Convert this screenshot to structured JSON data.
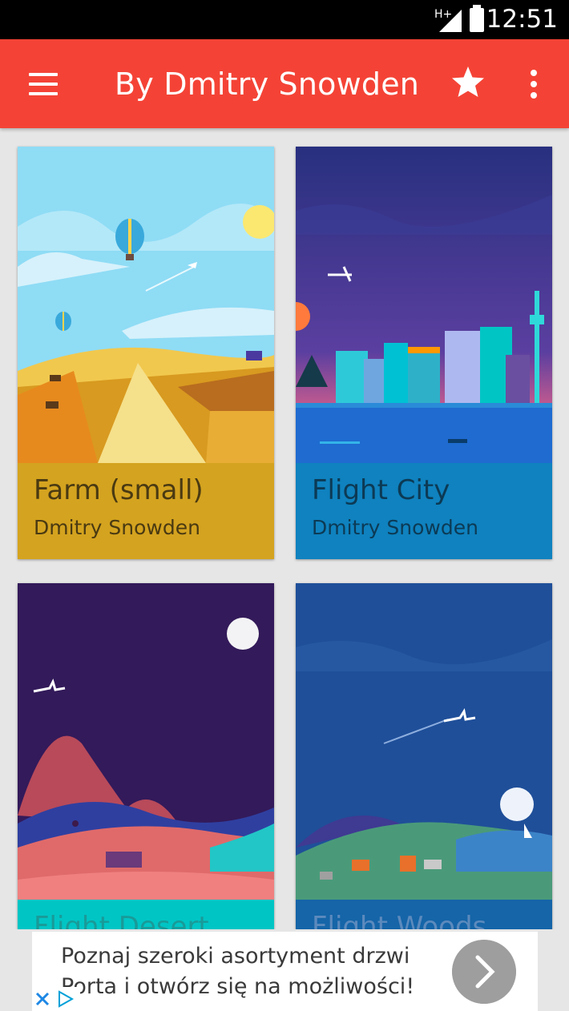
{
  "status_bar": {
    "time": "12:51",
    "network": "H+"
  },
  "app_bar": {
    "title": "By Dmitry Snowden",
    "menu_icon": "hamburger-menu-icon",
    "favorite_icon": "star-icon",
    "overflow_icon": "more-vert-icon",
    "color": "#f44336"
  },
  "cards": [
    {
      "title": "Farm (small)",
      "author": "Dmitry Snowden",
      "caption_color": "#d4a31f"
    },
    {
      "title": "Flight City",
      "author": "Dmitry Snowden",
      "caption_color": "#0f82bf"
    },
    {
      "title": "Flight Desert",
      "author": "",
      "caption_color": "#00c5c5"
    },
    {
      "title": "Flight Woods",
      "author": "",
      "caption_color": "#1565a8"
    }
  ],
  "ad": {
    "line1": "Poznaj szeroki asortyment drzwi",
    "line2": "Porta i otwórz się na możliwości!",
    "go_icon": "chevron-right-icon",
    "close_icon": "close-icon",
    "adchoices_icon": "adchoices-icon"
  }
}
